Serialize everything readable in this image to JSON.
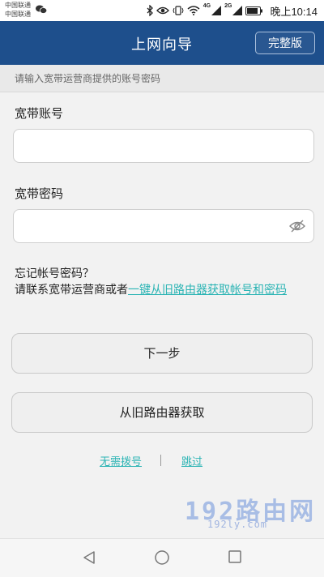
{
  "status_bar": {
    "carrier_1": "中国联通",
    "carrier_2": "中国联通",
    "signal_tag_1": "4G",
    "signal_tag_2": "2G",
    "time": "晚上10:14"
  },
  "header": {
    "title": "上网向导",
    "full_version_button": "完整版",
    "background_color": "#1e4f8c"
  },
  "hint": "请输入宽带运营商提供的账号密码",
  "form": {
    "account_label": "宽带账号",
    "account_value": "",
    "password_label": "宽带密码",
    "password_value": ""
  },
  "forgot": {
    "line1": "忘记帐号密码？",
    "prefix": "请联系宽带运营商或者",
    "link": "一键从旧路由器获取帐号和密码",
    "link_color": "#2bb4b4"
  },
  "buttons": {
    "next": "下一步",
    "from_old_router": "从旧路由器获取"
  },
  "bottom_links": {
    "no_dial": "无需拨号",
    "skip": "跳过"
  },
  "watermark": {
    "main": "192路由网",
    "sub": "192ly.com"
  },
  "nav_icons": [
    "back-icon",
    "home-icon",
    "recents-icon"
  ]
}
